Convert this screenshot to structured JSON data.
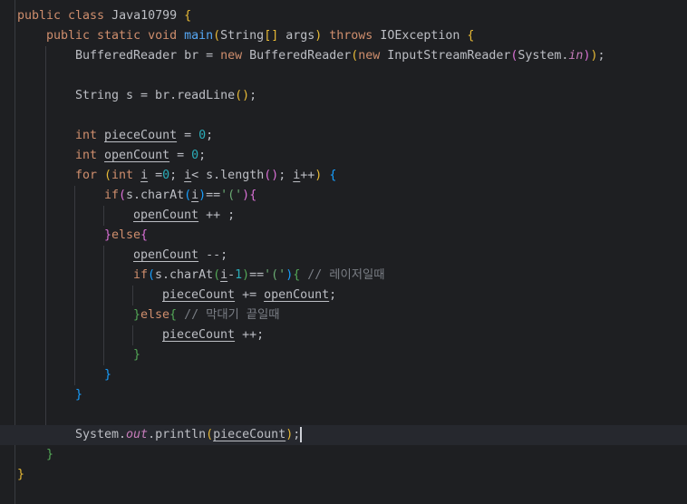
{
  "editor": {
    "lines": [
      {
        "indent": 0,
        "tokens": [
          [
            "public class ",
            "k"
          ],
          [
            "Java10799 ",
            "t"
          ],
          [
            "{",
            "y"
          ]
        ]
      },
      {
        "indent": 1,
        "tokens": [
          [
            "public static void ",
            "k"
          ],
          [
            "main",
            "m"
          ],
          [
            "(",
            "y"
          ],
          [
            "String",
            "t"
          ],
          [
            "[]",
            "y"
          ],
          [
            " args",
            "t"
          ],
          [
            ")",
            "y"
          ],
          [
            " throws ",
            "k"
          ],
          [
            "IOException ",
            "t"
          ],
          [
            "{",
            "y"
          ]
        ]
      },
      {
        "indent": 2,
        "tokens": [
          [
            "BufferedReader br = ",
            "t"
          ],
          [
            "new ",
            "k"
          ],
          [
            "BufferedReader",
            "t"
          ],
          [
            "(",
            "y"
          ],
          [
            "new ",
            "k"
          ],
          [
            "InputStreamReader",
            "t"
          ],
          [
            "(",
            "p"
          ],
          [
            "System.",
            "t"
          ],
          [
            "in",
            "f"
          ],
          [
            ")",
            "p"
          ],
          [
            ")",
            "y"
          ],
          [
            ";",
            "t"
          ]
        ]
      },
      {
        "indent": 0,
        "tokens": []
      },
      {
        "indent": 2,
        "tokens": [
          [
            "String s = br.readLine",
            "t"
          ],
          [
            "()",
            "y"
          ],
          [
            ";",
            "t"
          ]
        ]
      },
      {
        "indent": 0,
        "tokens": []
      },
      {
        "indent": 2,
        "tokens": [
          [
            "int ",
            "k"
          ],
          [
            "pieceCount",
            "u"
          ],
          [
            " = ",
            "t"
          ],
          [
            "0",
            "n"
          ],
          [
            ";",
            "t"
          ]
        ]
      },
      {
        "indent": 2,
        "tokens": [
          [
            "int ",
            "k"
          ],
          [
            "openCount",
            "u"
          ],
          [
            " = ",
            "t"
          ],
          [
            "0",
            "n"
          ],
          [
            ";",
            "t"
          ]
        ]
      },
      {
        "indent": 2,
        "tokens": [
          [
            "for ",
            "k"
          ],
          [
            "(",
            "y"
          ],
          [
            "int ",
            "k"
          ],
          [
            "i",
            "u"
          ],
          [
            " =",
            "t"
          ],
          [
            "0",
            "n"
          ],
          [
            "; ",
            "t"
          ],
          [
            "i",
            "u"
          ],
          [
            "< s.length",
            "t"
          ],
          [
            "()",
            "p"
          ],
          [
            "; ",
            "t"
          ],
          [
            "i",
            "u"
          ],
          [
            "++",
            "t"
          ],
          [
            ")",
            "y"
          ],
          [
            " ",
            "t"
          ],
          [
            "{",
            "bl"
          ]
        ]
      },
      {
        "indent": 3,
        "tokens": [
          [
            "if",
            "k"
          ],
          [
            "(",
            "p"
          ],
          [
            "s.charAt",
            "t"
          ],
          [
            "(",
            "bl"
          ],
          [
            "i",
            "u"
          ],
          [
            ")",
            "bl"
          ],
          [
            "==",
            "t"
          ],
          [
            "'('",
            "s"
          ],
          [
            ")",
            "p"
          ],
          [
            "{",
            "p"
          ]
        ]
      },
      {
        "indent": 4,
        "tokens": [
          [
            "openCount",
            "u"
          ],
          [
            " ++ ;",
            "t"
          ]
        ]
      },
      {
        "indent": 3,
        "tokens": [
          [
            "}",
            "p"
          ],
          [
            "else",
            "k"
          ],
          [
            "{",
            "p"
          ]
        ]
      },
      {
        "indent": 4,
        "tokens": [
          [
            "openCount",
            "u"
          ],
          [
            " --;",
            "t"
          ]
        ]
      },
      {
        "indent": 4,
        "tokens": [
          [
            "if",
            "k"
          ],
          [
            "(",
            "bl"
          ],
          [
            "s.charAt",
            "t"
          ],
          [
            "(",
            "g"
          ],
          [
            "i",
            "u"
          ],
          [
            "-",
            "t"
          ],
          [
            "1",
            "n"
          ],
          [
            ")",
            "g"
          ],
          [
            "==",
            "t"
          ],
          [
            "'('",
            "s"
          ],
          [
            ")",
            "bl"
          ],
          [
            "{",
            "g"
          ],
          [
            " // 레이저일때",
            "c"
          ]
        ]
      },
      {
        "indent": 5,
        "tokens": [
          [
            "pieceCount",
            "u"
          ],
          [
            " += ",
            "t"
          ],
          [
            "openCount",
            "u"
          ],
          [
            ";",
            "t"
          ]
        ]
      },
      {
        "indent": 4,
        "tokens": [
          [
            "}",
            "g"
          ],
          [
            "else",
            "k"
          ],
          [
            "{",
            "g"
          ],
          [
            " // 막대기 끝일때",
            "c"
          ]
        ]
      },
      {
        "indent": 5,
        "tokens": [
          [
            "pieceCount",
            "u"
          ],
          [
            " ++;",
            "t"
          ]
        ]
      },
      {
        "indent": 4,
        "tokens": [
          [
            "}",
            "g"
          ]
        ]
      },
      {
        "indent": 3,
        "tokens": [
          [
            "}",
            "bl"
          ]
        ]
      },
      {
        "indent": 2,
        "tokens": [
          [
            "}",
            "bl"
          ]
        ]
      },
      {
        "indent": 0,
        "tokens": []
      },
      {
        "indent": 2,
        "tokens": [
          [
            "System.",
            "t"
          ],
          [
            "out",
            "f"
          ],
          [
            ".println",
            "t"
          ],
          [
            "(",
            "y"
          ],
          [
            "pieceCount",
            "u"
          ],
          [
            ")",
            "y"
          ],
          [
            ";",
            "t"
          ]
        ],
        "current": true
      },
      {
        "indent": 1,
        "tokens": [
          [
            "}",
            "g"
          ]
        ]
      },
      {
        "indent": 0,
        "tokens": [
          [
            "}",
            "y"
          ]
        ]
      }
    ]
  }
}
